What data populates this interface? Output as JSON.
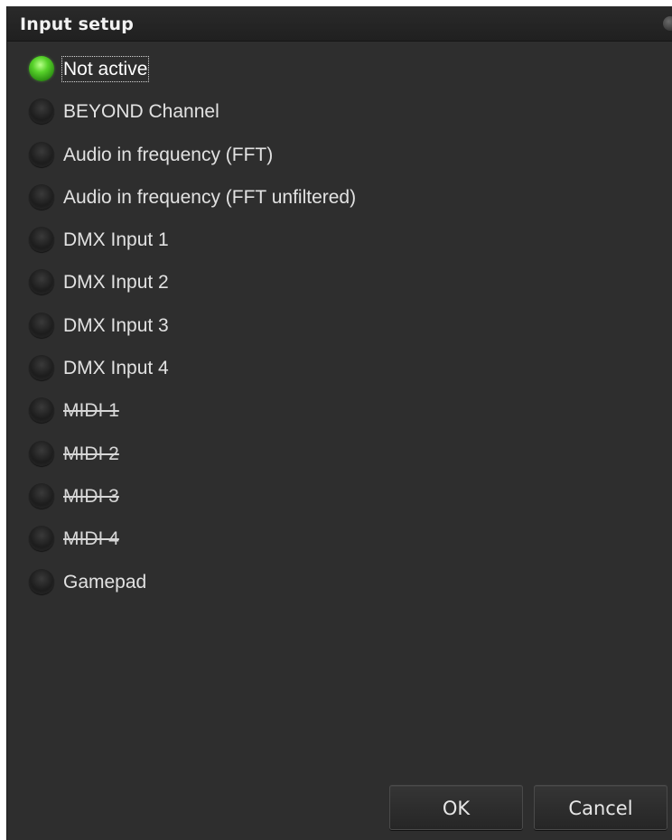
{
  "window": {
    "title": "Input setup"
  },
  "options": [
    {
      "label": "Not active",
      "checked": true,
      "disabled": false,
      "focused": true
    },
    {
      "label": "BEYOND Channel",
      "checked": false,
      "disabled": false,
      "focused": false
    },
    {
      "label": "Audio in frequency (FFT)",
      "checked": false,
      "disabled": false,
      "focused": false
    },
    {
      "label": "Audio in frequency (FFT unfiltered)",
      "checked": false,
      "disabled": false,
      "focused": false
    },
    {
      "label": "DMX Input 1",
      "checked": false,
      "disabled": false,
      "focused": false
    },
    {
      "label": "DMX Input 2",
      "checked": false,
      "disabled": false,
      "focused": false
    },
    {
      "label": "DMX Input 3",
      "checked": false,
      "disabled": false,
      "focused": false
    },
    {
      "label": "DMX Input 4",
      "checked": false,
      "disabled": false,
      "focused": false
    },
    {
      "label": "MIDI 1",
      "checked": false,
      "disabled": true,
      "focused": false
    },
    {
      "label": "MIDI 2",
      "checked": false,
      "disabled": true,
      "focused": false
    },
    {
      "label": "MIDI 3",
      "checked": false,
      "disabled": true,
      "focused": false
    },
    {
      "label": "MIDI 4",
      "checked": false,
      "disabled": true,
      "focused": false
    },
    {
      "label": "Gamepad",
      "checked": false,
      "disabled": false,
      "focused": false
    }
  ],
  "buttons": {
    "ok_label": "OK",
    "cancel_label": "Cancel"
  },
  "colors": {
    "background": "#2e2e2e",
    "titlebar": "#222222",
    "radio_checked": "#57d22a",
    "text": "#e2e2e2"
  }
}
